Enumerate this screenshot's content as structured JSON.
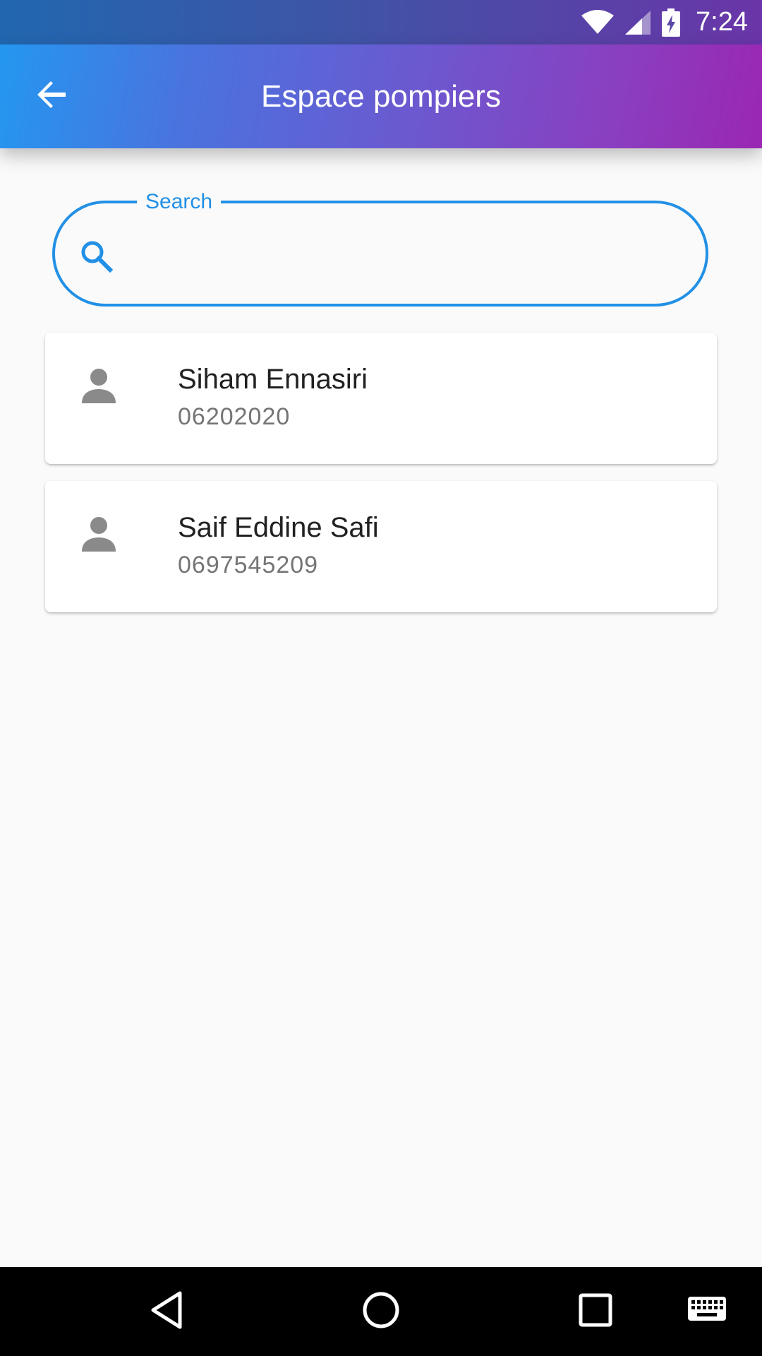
{
  "status_bar": {
    "time": "7:24",
    "icons": [
      "wifi-icon",
      "signal-icon",
      "battery-charging-icon"
    ]
  },
  "app_bar": {
    "title": "Espace pompiers",
    "back_icon": "arrow-back-icon"
  },
  "search": {
    "label": "Search",
    "value": "",
    "placeholder": "",
    "icon": "search-icon"
  },
  "contacts": [
    {
      "name": "Siham Ennasiri",
      "phone": "06202020",
      "icon": "person-icon"
    },
    {
      "name": "Saif Eddine Safi",
      "phone": "0697545209",
      "icon": "person-icon"
    }
  ],
  "nav_bar": {
    "buttons": [
      "back-triangle-icon",
      "home-circle-icon",
      "recents-square-icon",
      "keyboard-icon"
    ]
  },
  "colors": {
    "accent": "#2290e6",
    "app_bar_start": "#2497f0",
    "app_bar_end": "#9a27b3",
    "avatar": "#8a8a8a",
    "background": "#fafafa"
  }
}
